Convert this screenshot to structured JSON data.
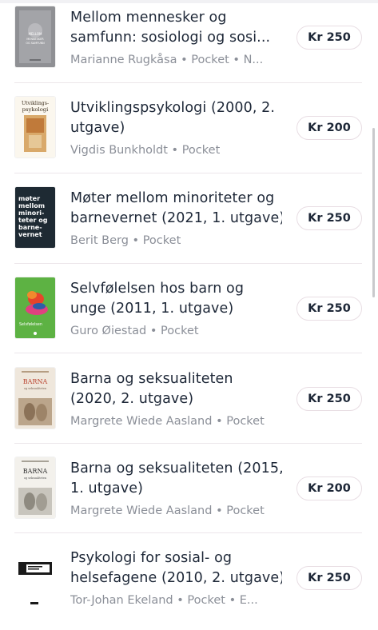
{
  "books": [
    {
      "title_line1": "Mellom mennesker og",
      "title_line2": "samfunn: sosiologi og sosi...",
      "meta": "Marianne Rugkåsa • Pocket • N...",
      "price": "Kr 250",
      "cover_text": [
        "MELLOM",
        "MENNESKER",
        "OG SAMFUNN"
      ]
    },
    {
      "title_line1": "Utviklingspsykologi (2000, 2.",
      "title_line2": "utgave)",
      "meta": "Vigdis Bunkholdt • Pocket",
      "price": "Kr 200",
      "cover_text": [
        "Utviklings-",
        "psykologi"
      ]
    },
    {
      "title_line1": "Møter mellom minoriteter og",
      "title_line2": "barnevernet (2021, 1. utgave)",
      "meta": "Berit Berg • Pocket",
      "price": "Kr 250",
      "cover_text": [
        "møter",
        "mellom",
        "minori-",
        "teter og",
        "barne-",
        "vernet"
      ]
    },
    {
      "title_line1": "Selvfølelsen hos barn og",
      "title_line2": "unge (2011, 1. utgave)",
      "meta": "Guro Øiestad • Pocket",
      "price": "Kr 250",
      "cover_text": [
        "Selvfølelsen"
      ]
    },
    {
      "title_line1": "Barna og seksualiteten",
      "title_line2": "(2020, 2. utgave)",
      "meta": "Margrete Wiede Aasland • Pocket",
      "price": "Kr 250",
      "cover_text": [
        "BARNA",
        "og seksualiteten"
      ]
    },
    {
      "title_line1": "Barna og seksualiteten (2015,",
      "title_line2": "1. utgave)",
      "meta": "Margrete Wiede Aasland • Pocket",
      "price": "Kr 200",
      "cover_text": [
        "BARNA",
        "og seksualiteten"
      ]
    },
    {
      "title_line1": "Psykologi for sosial- og",
      "title_line2": "helsefagene (2010, 2. utgave)",
      "meta": "Tor-Johan Ekeland • Pocket • E...",
      "price": "Kr 250",
      "cover_text": []
    }
  ],
  "colors": {
    "text": "#1d2737",
    "meta": "#8b8f98",
    "divider": "#ece6ea",
    "price_border": "#e8dde3"
  }
}
